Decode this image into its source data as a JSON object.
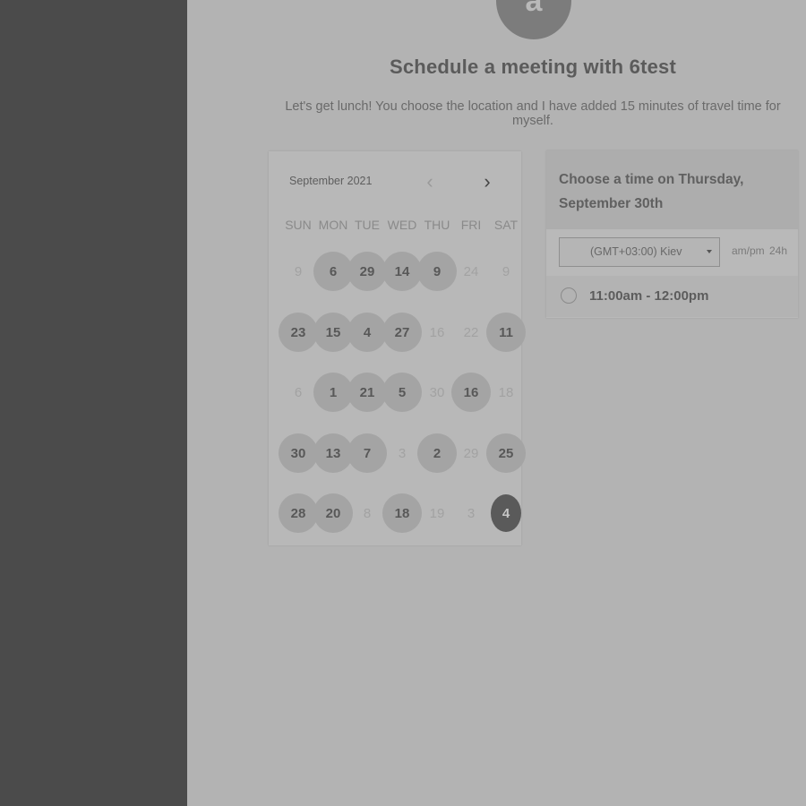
{
  "host": {
    "avatar_initial": "a"
  },
  "title": "Schedule a meeting with 6test",
  "description": "Let's get lunch! You choose the location and I have added 15 minutes of travel time for myself.",
  "calendar": {
    "month_label": "September 2021",
    "prev_icon": "chevron-left-icon",
    "next_icon": "chevron-right-icon",
    "weekdays": [
      "SUN",
      "MON",
      "TUE",
      "WED",
      "THU",
      "FRI",
      "SAT"
    ],
    "weeks": [
      [
        {
          "label": "9",
          "state": "unavailable"
        },
        {
          "label": "6",
          "state": "available"
        },
        {
          "label": "29",
          "state": "available"
        },
        {
          "label": "14",
          "state": "available"
        },
        {
          "label": "9",
          "state": "available"
        },
        {
          "label": "24",
          "state": "unavailable"
        },
        {
          "label": "9",
          "state": "unavailable"
        }
      ],
      [
        {
          "label": "23",
          "state": "available"
        },
        {
          "label": "15",
          "state": "available"
        },
        {
          "label": "4",
          "state": "available"
        },
        {
          "label": "27",
          "state": "available"
        },
        {
          "label": "16",
          "state": "unavailable"
        },
        {
          "label": "22",
          "state": "unavailable"
        },
        {
          "label": "11",
          "state": "available"
        }
      ],
      [
        {
          "label": "6",
          "state": "unavailable"
        },
        {
          "label": "1",
          "state": "available"
        },
        {
          "label": "21",
          "state": "available"
        },
        {
          "label": "5",
          "state": "available"
        },
        {
          "label": "30",
          "state": "unavailable"
        },
        {
          "label": "16",
          "state": "available"
        },
        {
          "label": "18",
          "state": "unavailable"
        }
      ],
      [
        {
          "label": "30",
          "state": "available"
        },
        {
          "label": "13",
          "state": "available"
        },
        {
          "label": "7",
          "state": "available"
        },
        {
          "label": "3",
          "state": "unavailable"
        },
        {
          "label": "2",
          "state": "available"
        },
        {
          "label": "29",
          "state": "unavailable"
        },
        {
          "label": "25",
          "state": "available"
        }
      ],
      [
        {
          "label": "28",
          "state": "available"
        },
        {
          "label": "20",
          "state": "available"
        },
        {
          "label": "8",
          "state": "unavailable"
        },
        {
          "label": "18",
          "state": "available"
        },
        {
          "label": "19",
          "state": "unavailable"
        },
        {
          "label": "3",
          "state": "unavailable"
        },
        {
          "label": "4",
          "state": "selected"
        }
      ]
    ]
  },
  "times": {
    "heading": "Choose a time on Thursday, September 30th",
    "timezone": "(GMT+03:00) Kiev",
    "format_ampm": "am/pm",
    "format_24h": "24h",
    "slots": [
      {
        "label": "11:00am - 12:00pm"
      }
    ]
  },
  "colors": {
    "sidebar": "#4b4b4b",
    "available_day": "#a4a4a4",
    "selected_day": "#5a5a5a"
  }
}
